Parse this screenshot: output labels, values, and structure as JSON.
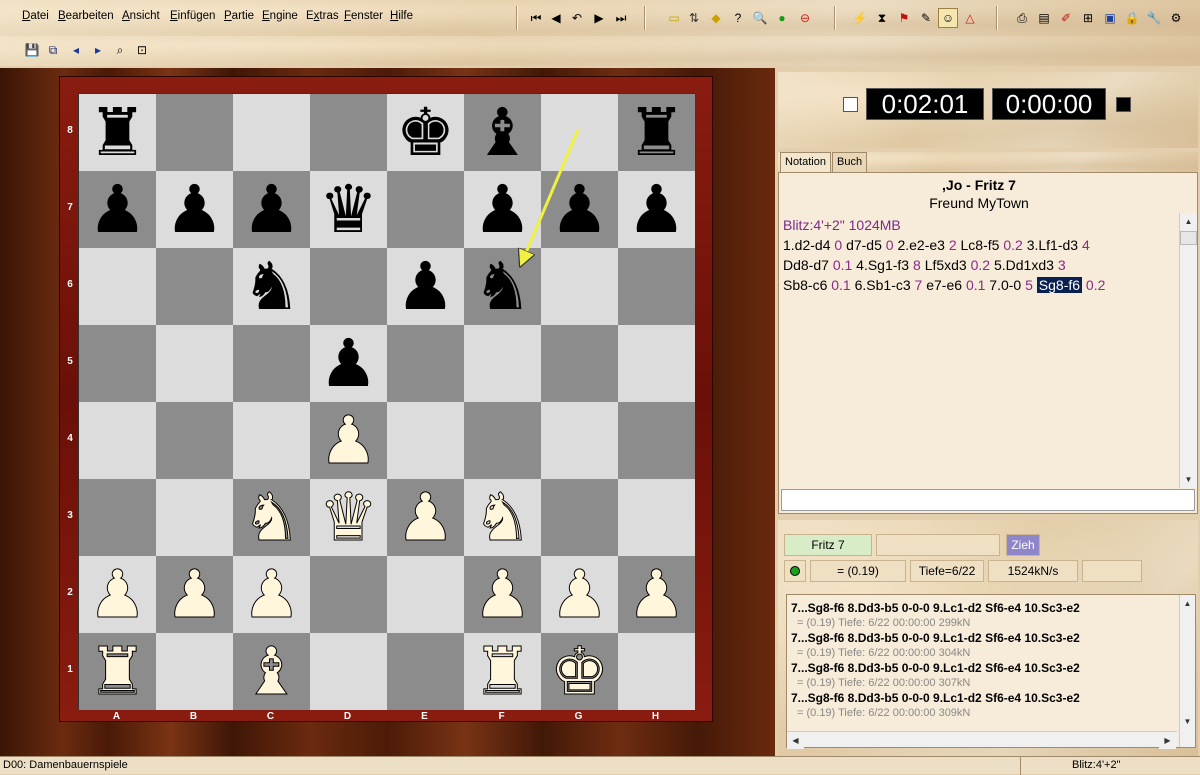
{
  "menu": [
    "Datei",
    "Bearbeiten",
    "Ansicht",
    "Einfügen",
    "Partie",
    "Engine",
    "Extras",
    "Fenster",
    "Hilfe"
  ],
  "menu_underline": [
    "D",
    "B",
    "A",
    "E",
    "P",
    "E",
    "x",
    "F",
    "H"
  ],
  "board": {
    "ranks": [
      "8",
      "7",
      "6",
      "5",
      "4",
      "3",
      "2",
      "1"
    ],
    "files": [
      "A",
      "B",
      "C",
      "D",
      "E",
      "F",
      "G",
      "H"
    ],
    "position": [
      [
        "bR",
        "",
        "",
        "",
        "bK",
        "bB",
        "",
        "bR"
      ],
      [
        "bP",
        "bP",
        "bP",
        "bQ",
        "",
        "bP",
        "bP",
        "bP"
      ],
      [
        "",
        "",
        "bN",
        "",
        "bP",
        "bN",
        "",
        ""
      ],
      [
        "",
        "",
        "",
        "bP",
        "",
        "",
        "",
        ""
      ],
      [
        "",
        "",
        "",
        "wP",
        "",
        "",
        "",
        ""
      ],
      [
        "",
        "",
        "wN",
        "wQ",
        "wP",
        "wN",
        "",
        ""
      ],
      [
        "wP",
        "wP",
        "wP",
        "",
        "",
        "wP",
        "wP",
        "wP"
      ],
      [
        "wR",
        "",
        "wB",
        "",
        "",
        "wR",
        "wK",
        ""
      ]
    ],
    "arrow": {
      "from": "f8",
      "to": "f6",
      "color": "#f0f040"
    }
  },
  "clocks": {
    "white": "0:02:01",
    "black": "0:00:00"
  },
  "tabs": [
    "Notation",
    "Buch"
  ],
  "notation": {
    "title": ",Jo - Fritz 7",
    "subtitle": "Freund MyTown",
    "header": "Blitz:4'+2\"  1024MB",
    "line1": [
      {
        "t": "1.d2-d4 ",
        "c": "m"
      },
      {
        "t": " 0 ",
        "c": "e"
      },
      {
        "t": " d7-d5 ",
        "c": "m"
      },
      {
        "t": "0 ",
        "c": "e"
      },
      {
        "t": " 2.e2-e3 ",
        "c": "m"
      },
      {
        "t": "2 ",
        "c": "e"
      },
      {
        "t": " Lc8-f5 ",
        "c": "m"
      },
      {
        "t": "0.2 ",
        "c": "e"
      },
      {
        "t": " 3.Lf1-d3 ",
        "c": "m"
      },
      {
        "t": "4",
        "c": "e"
      }
    ],
    "line2": [
      {
        "t": "Dd8-d7 ",
        "c": "m"
      },
      {
        "t": " 0.1 ",
        "c": "e"
      },
      {
        "t": " 4.Sg1-f3 ",
        "c": "m"
      },
      {
        "t": "8 ",
        "c": "e"
      },
      {
        "t": " Lf5xd3 ",
        "c": "m"
      },
      {
        "t": " 0.2 ",
        "c": "e"
      },
      {
        "t": " 5.Dd1xd3 ",
        "c": "m"
      },
      {
        "t": " 3",
        "c": "e"
      }
    ],
    "line3": [
      {
        "t": "Sb8-c6 ",
        "c": "m"
      },
      {
        "t": " 0.1 ",
        "c": "e"
      },
      {
        "t": " 6.Sb1-c3 ",
        "c": "m"
      },
      {
        "t": " 7 ",
        "c": "e"
      },
      {
        "t": " e7-e6 ",
        "c": "m"
      },
      {
        "t": " 0.1 ",
        "c": "e"
      },
      {
        "t": " 7.0-0 ",
        "c": "m"
      },
      {
        "t": " 5 ",
        "c": "e"
      },
      {
        "t": "Sg8-f6",
        "c": "cur"
      },
      {
        "t": " 0.2",
        "c": "e"
      }
    ]
  },
  "engine": {
    "name": "Fritz 7",
    "move_button": "Zieh",
    "eval": "= (0.19)",
    "depth": "Tiefe=6/22",
    "speed": "1524kN/s",
    "lines": [
      {
        "pv": "7...Sg8-f6 8.Dd3-b5 0-0-0 9.Lc1-d2 Sf6-e4 10.Sc3-e2",
        "info": "=  (0.19)   Tiefe: 6/22   00:00:00  299kN"
      },
      {
        "pv": "7...Sg8-f6 8.Dd3-b5 0-0-0 9.Lc1-d2 Sf6-e4 10.Sc3-e2",
        "info": "=  (0.19)   Tiefe: 6/22   00:00:00  304kN"
      },
      {
        "pv": "7...Sg8-f6 8.Dd3-b5 0-0-0 9.Lc1-d2 Sf6-e4 10.Sc3-e2",
        "info": "=  (0.19)   Tiefe: 6/22   00:00:00  307kN"
      },
      {
        "pv": "7...Sg8-f6 8.Dd3-b5 0-0-0 9.Lc1-d2 Sf6-e4 10.Sc3-e2",
        "info": "=  (0.19)   Tiefe: 6/22   00:00:00  309kN"
      }
    ]
  },
  "status": {
    "left": "D00: Damenbauernspiele",
    "right": "Blitz:4'+2\""
  }
}
